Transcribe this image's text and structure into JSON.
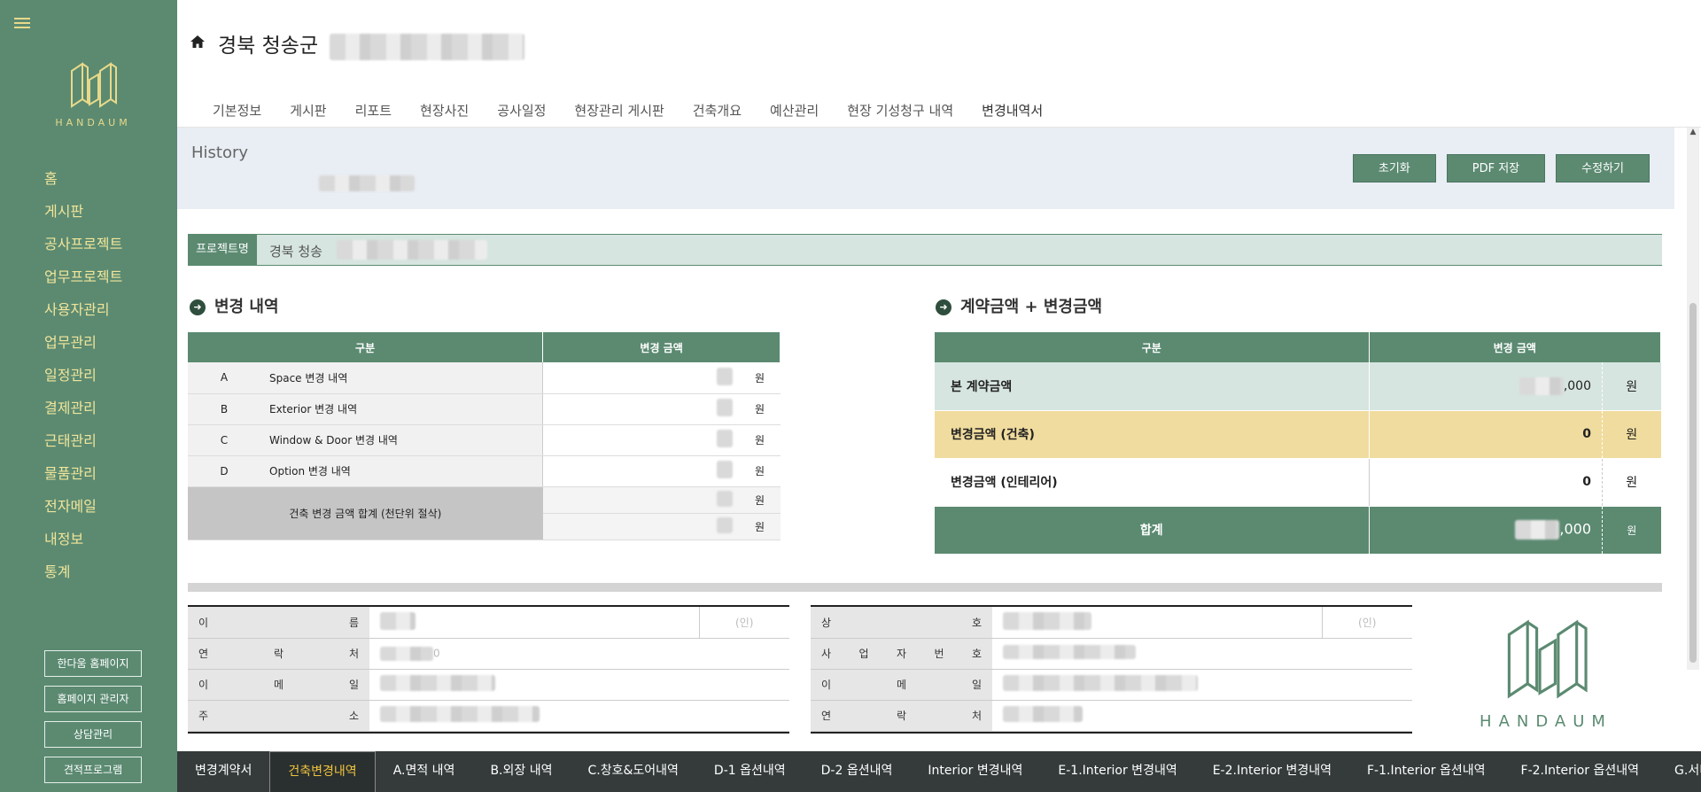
{
  "sidebar": {
    "logo_text": "HANDAUM",
    "nav": [
      "홈",
      "게시판",
      "공사프로젝트",
      "업무프로젝트",
      "사용자관리",
      "업무관리",
      "일정관리",
      "결제관리",
      "근태관리",
      "물품관리",
      "전자메일",
      "내정보",
      "통계"
    ],
    "buttons": [
      "한다움 홈페이지",
      "홈페이지 관리자",
      "상담관리",
      "견적프로그램"
    ]
  },
  "header": {
    "title": "경북 청송군",
    "tabs": [
      "기본정보",
      "게시판",
      "리포트",
      "현장사진",
      "공사일정",
      "현장관리 게시판",
      "건축개요",
      "예산관리",
      "현장 기성청구 내역",
      "변경내역서"
    ],
    "active_tab": "변경내역서"
  },
  "history": {
    "label": "History",
    "buttons": [
      "초기화",
      "PDF 저장",
      "수정하기"
    ]
  },
  "project": {
    "label": "프로젝트명",
    "value": "경북 청송"
  },
  "change_section": {
    "title": "변경 내역",
    "headers": [
      "구분",
      "변경 금액"
    ],
    "rows": [
      {
        "code": "A",
        "name": "Space 변경 내역",
        "unit": "원"
      },
      {
        "code": "B",
        "name": "Exterior 변경 내역",
        "unit": "원"
      },
      {
        "code": "C",
        "name": "Window & Door 변경 내역",
        "unit": "원"
      },
      {
        "code": "D",
        "name": "Option 변경 내역",
        "unit": "원"
      }
    ],
    "sum_label": "건축 변경 금액 합계 (천단위 절삭)",
    "sum_units": [
      "원",
      "원"
    ]
  },
  "contract_section": {
    "title": "계약금액 + 변경금액",
    "headers": [
      "구분",
      "변경 금액"
    ],
    "rows": [
      {
        "name": "본 계약금액",
        "value": ",000",
        "unit": "원"
      },
      {
        "name": "변경금액 (건축)",
        "value": "0",
        "unit": "원"
      },
      {
        "name": "변경금액 (인테리어)",
        "value": "0",
        "unit": "원"
      }
    ],
    "total": {
      "name": "합계",
      "value": ",000",
      "unit": "원"
    }
  },
  "person_info": {
    "fields": [
      "이름",
      "연락처",
      "이메일",
      "주소"
    ],
    "contact_partial": "0",
    "seal": "(인)"
  },
  "company_info": {
    "fields": [
      "상호",
      "사업자번호",
      "이메일",
      "연락처"
    ],
    "seal": "(인)"
  },
  "bottom_tabs": [
    "변경계약서",
    "건축변경내역",
    "A.면적 내역",
    "B.외장 내역",
    "C.창호&도어내역",
    "D-1 옵션내역",
    "D-2 옵션내역",
    "Interior 변경내역",
    "E-1.Interior 변경내역",
    "E-2.Interior 변경내역",
    "F-1.Interior 옵션내역",
    "F-2.Interior 옵션내역",
    "G.서비"
  ],
  "bottom_active": "건축변경내역",
  "colors": {
    "primary": "#5b8a71",
    "accent_yellow": "#f0dc9e",
    "nav_text": "#f1e59a"
  }
}
